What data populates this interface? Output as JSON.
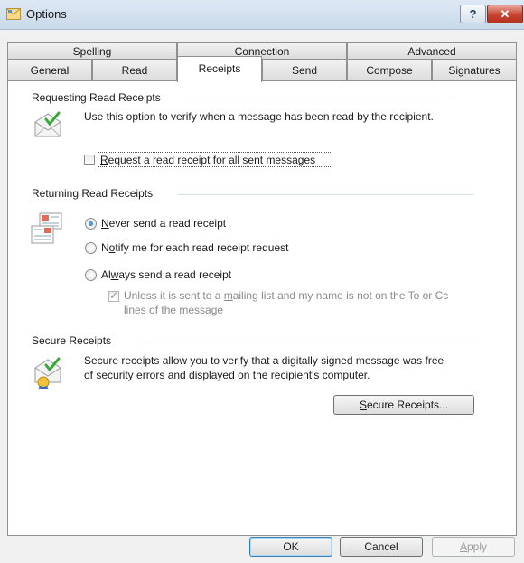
{
  "window": {
    "title": "Options",
    "help_label": "?",
    "close_label": "✕"
  },
  "tabs_row1": [
    {
      "label": "Spelling"
    },
    {
      "label": "Connection"
    },
    {
      "label": "Advanced"
    }
  ],
  "tabs_row2": [
    {
      "label": "General"
    },
    {
      "label": "Read"
    },
    {
      "label": "Receipts"
    },
    {
      "label": "Send"
    },
    {
      "label": "Compose"
    },
    {
      "label": "Signatures"
    }
  ],
  "active_tab": "Receipts",
  "requesting": {
    "heading": "Requesting Read Receipts",
    "description": "Use this option to verify when a message has been read by the recipient.",
    "checkbox_label_pre": "",
    "checkbox_label_key": "R",
    "checkbox_label_post": "equest a read receipt for all sent messages",
    "checkbox_checked": false
  },
  "returning": {
    "heading": "Returning Read Receipts",
    "options": [
      {
        "pre": "",
        "key": "N",
        "post": "ever send a read receipt",
        "selected": true
      },
      {
        "pre": "N",
        "key": "o",
        "post": "tify me for each read receipt request",
        "selected": false
      },
      {
        "pre": "Al",
        "key": "w",
        "post": "ays send a read receipt",
        "selected": false
      }
    ],
    "sub_checkbox_line1_pre": "Unless it is sent to a ",
    "sub_checkbox_line1_key": "m",
    "sub_checkbox_line1_post": "ailing list and my name is not on the To or Cc",
    "sub_checkbox_line2": "lines of the message",
    "sub_checkbox_checked": true,
    "sub_checkbox_enabled": false
  },
  "secure": {
    "heading": "Secure Receipts",
    "description_line1": "Secure receipts allow you to verify that a digitally signed message was free",
    "description_line2": "of security errors and displayed on the recipient's computer.",
    "button_key": "S",
    "button_rest": "ecure Receipts..."
  },
  "buttons": {
    "ok": "OK",
    "cancel": "Cancel",
    "apply_key": "A",
    "apply_rest": "pply",
    "apply_enabled": false
  }
}
